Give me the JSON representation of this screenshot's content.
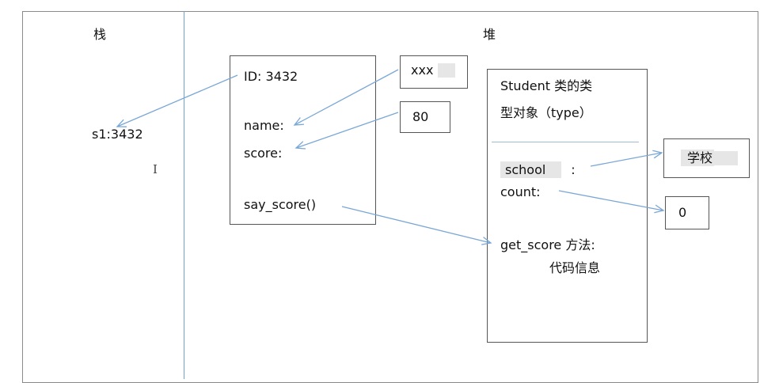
{
  "stack": {
    "title": "栈",
    "var": "s1:3432"
  },
  "heap": {
    "title": "堆"
  },
  "object": {
    "id": "ID: 3432",
    "name": "name:",
    "score": "score:",
    "method": "say_score()"
  },
  "values": {
    "name": "xxx",
    "score": "80",
    "school": "学校",
    "count": "0"
  },
  "type_object": {
    "title_line1": "Student 类的类",
    "title_line2": "型对象（type）",
    "school": "school",
    "school_colon": ":",
    "count": "count:",
    "method_line1": "get_score 方法:",
    "method_line2": "代码信息"
  },
  "cursor_glyph": "I",
  "colors": {
    "arrow": "#7aa7d6",
    "divider": "#6fa0d3",
    "border": "#555555"
  }
}
